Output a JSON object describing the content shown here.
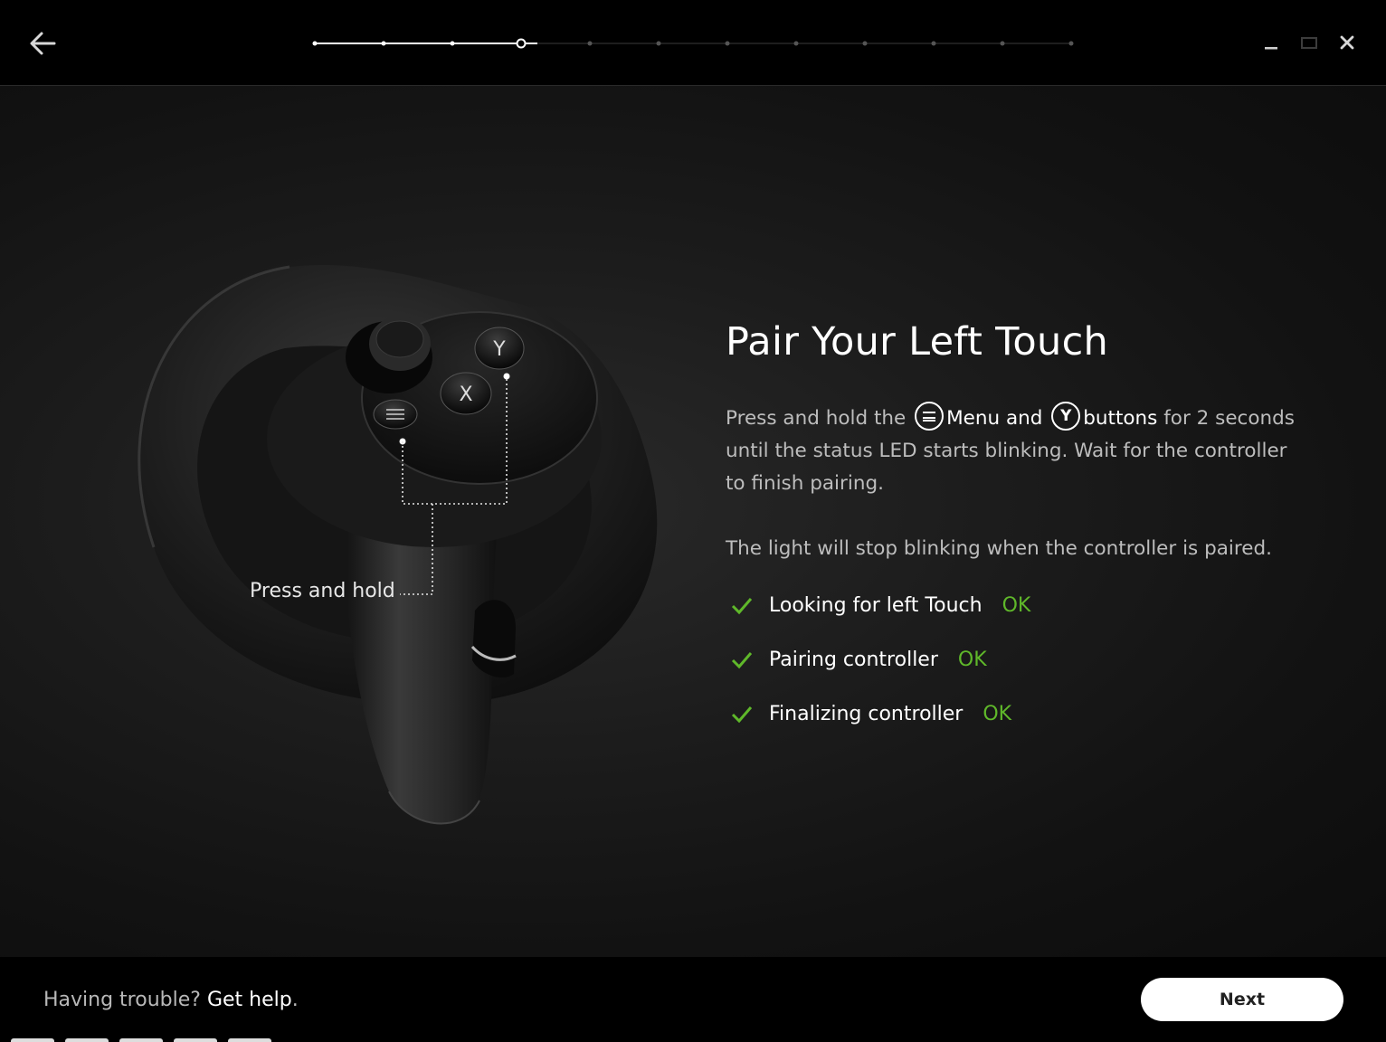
{
  "window": {
    "progress": {
      "total_steps": 12,
      "current_step": 4
    }
  },
  "main": {
    "illustration": {
      "callout_label": "Press and hold"
    },
    "title": "Pair Your Left Touch",
    "instruction": {
      "part1": "Press and hold the",
      "menu_word": "Menu",
      "and_word": "and",
      "y_icon_letter": "Y",
      "buttons_word": "buttons",
      "part2": "for 2 seconds until the status LED starts blinking. Wait for the controller to finish pairing."
    },
    "note": "The light will stop blinking when the controller is paired.",
    "status_items": [
      {
        "label": "Looking for left Touch",
        "status": "OK"
      },
      {
        "label": "Pairing controller",
        "status": "OK"
      },
      {
        "label": "Finalizing controller",
        "status": "OK"
      }
    ]
  },
  "footer": {
    "help_prefix": "Having trouble?",
    "help_link": "Get help",
    "help_suffix": ".",
    "next_label": "Next"
  },
  "colors": {
    "ok_green": "#5fb82a",
    "background": "#000000",
    "button_bg": "#ffffff"
  }
}
